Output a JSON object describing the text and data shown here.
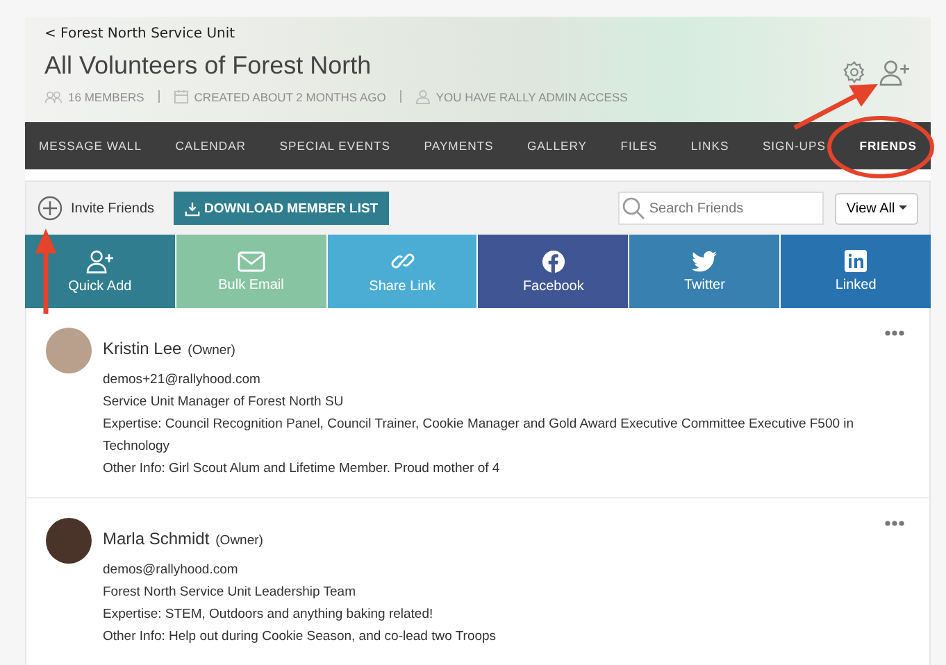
{
  "breadcrumb": "< Forest North Service Unit",
  "title": "All Volunteers of Forest North",
  "meta": [
    {
      "kind": "members",
      "text": "16 MEMBERS"
    },
    {
      "kind": "calendar",
      "text": "CREATED ABOUT 2 MONTHS AGO"
    },
    {
      "kind": "user",
      "text": "YOU HAVE RALLY ADMIN ACCESS"
    }
  ],
  "tabs": [
    {
      "label": "MESSAGE WALL",
      "selected": false
    },
    {
      "label": "CALENDAR",
      "selected": false
    },
    {
      "label": "SPECIAL EVENTS",
      "selected": false
    },
    {
      "label": "PAYMENTS",
      "selected": false
    },
    {
      "label": "GALLERY",
      "selected": false
    },
    {
      "label": "FILES",
      "selected": false
    },
    {
      "label": "LINKS",
      "selected": false
    },
    {
      "label": "SIGN-UPS",
      "selected": false
    },
    {
      "label": "FRIENDS",
      "selected": true
    }
  ],
  "toolbar": {
    "invite": "Invite Friends",
    "download": "DOWNLOAD MEMBER LIST",
    "search": {
      "placeholder": "Search Friends"
    },
    "view": "View All"
  },
  "share": [
    {
      "kind": "user-plus",
      "label": "Quick Add",
      "color": "#2f7d8f"
    },
    {
      "kind": "mail",
      "label": "Bulk Email",
      "color": "#86c4a2"
    },
    {
      "kind": "link",
      "label": "Share Link",
      "color": "#4badd4"
    },
    {
      "kind": "facebook",
      "label": "Facebook",
      "color": "#405694"
    },
    {
      "kind": "twitter",
      "label": "Twitter",
      "color": "#3780b0"
    },
    {
      "kind": "linkedin",
      "label": "Linked",
      "color": "#2872b0"
    }
  ],
  "members": [
    {
      "name": "Kristin Lee",
      "role": "(Owner)",
      "lines": [
        "demos+21@rallyhood.com",
        "Service Unit Manager of Forest North SU",
        "Expertise: Council Recognition Panel, Council Trainer, Cookie Manager and Gold Award Executive Committee Executive F500 in Technology",
        "Other Info: Girl Scout Alum and Lifetime Member. Proud mother of 4"
      ]
    },
    {
      "name": "Marla Schmidt",
      "role": "(Owner)",
      "lines": [
        "demos@rallyhood.com",
        "Forest North Service Unit Leadership Team",
        "Expertise: STEM, Outdoors and anything baking related!",
        "Other Info: Help out during Cookie Season, and co-lead two Troops"
      ]
    }
  ]
}
